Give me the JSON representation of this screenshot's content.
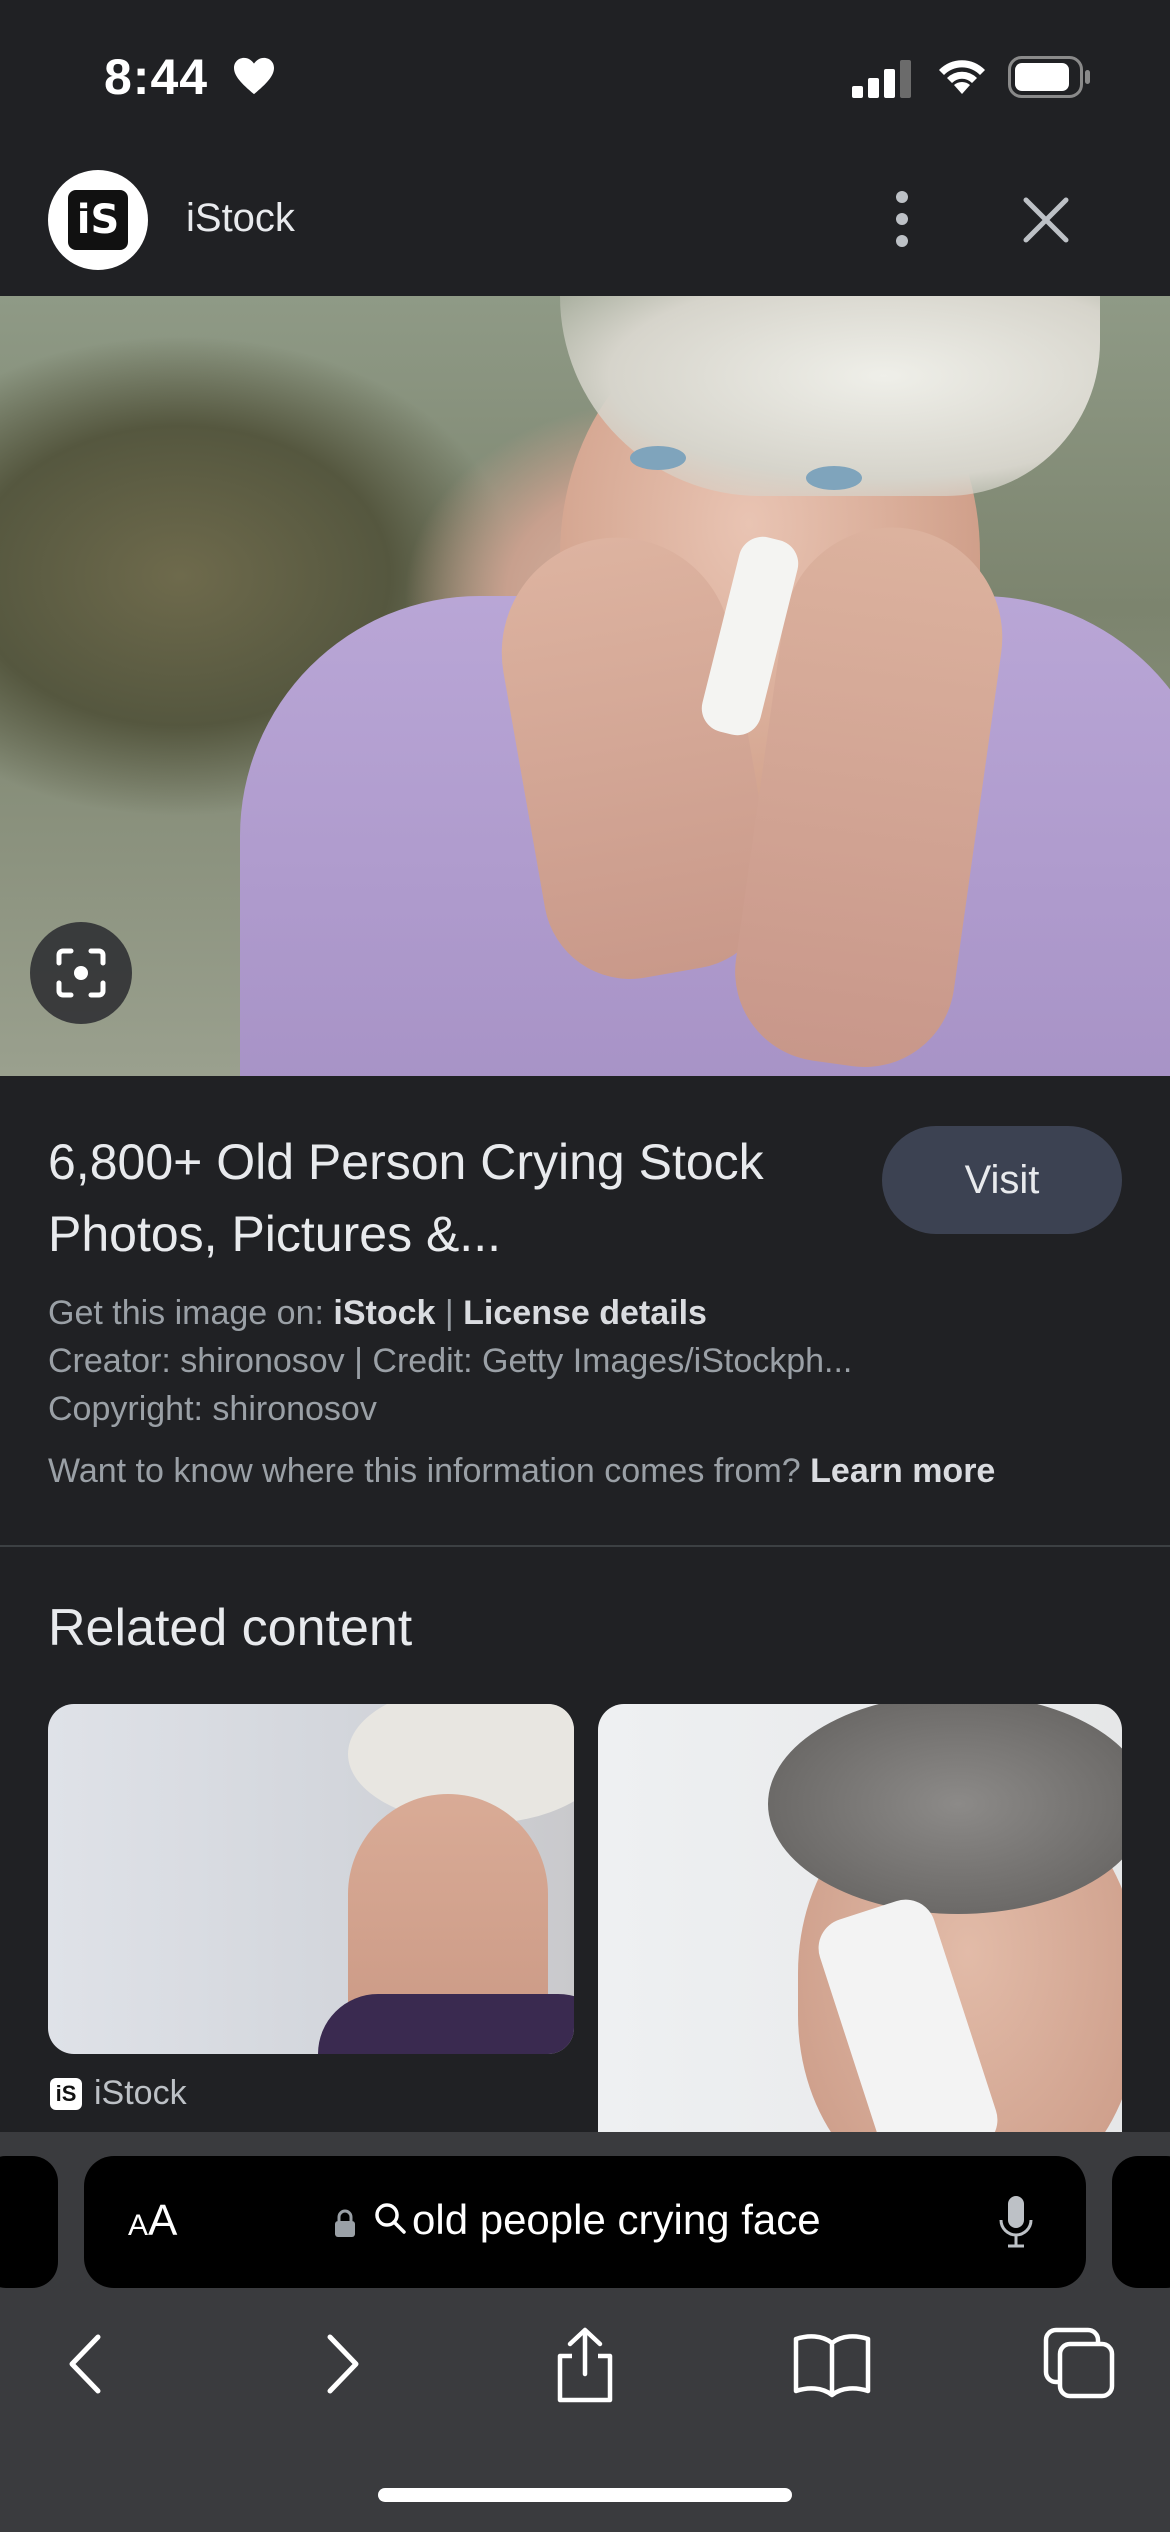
{
  "status_bar": {
    "time": "8:44"
  },
  "header": {
    "site_logo_text": "iS",
    "site_name": "iStock"
  },
  "result": {
    "title": "6,800+ Old Person Crying Stock Photos, Pictures &...",
    "visit_label": "Visit",
    "get_image_prefix": "Get this image on: ",
    "get_image_source": "iStock",
    "separator": " | ",
    "license_label": "License details",
    "creator_line": "Creator: shironosov | Credit: Getty Images/iStockph...",
    "copyright_line": "Copyright: shironosov",
    "info_question": "Want to know where this information comes from? ",
    "learn_more_label": "Learn more"
  },
  "related": {
    "title": "Related content",
    "items": [
      {
        "source": "iStock",
        "source_logo_text": "iS"
      }
    ]
  },
  "browser": {
    "aa_small": "A",
    "aa_large": "A",
    "address_text": "old people crying face"
  },
  "colors": {
    "background": "#202124",
    "visit_button": "#3c4252",
    "bottom_bar": "#3a3b3e"
  }
}
